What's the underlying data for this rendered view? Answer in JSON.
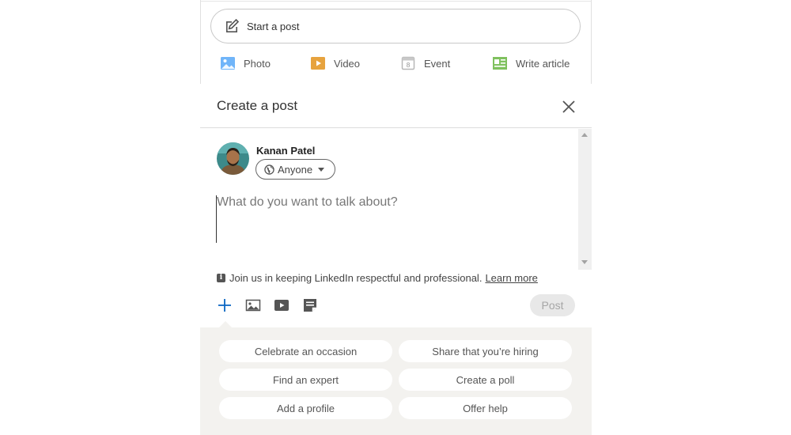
{
  "share_box": {
    "start_post_label": "Start a post",
    "actions": [
      {
        "label": "Photo",
        "icon": "photo-icon",
        "color": "#70b5f9"
      },
      {
        "label": "Video",
        "icon": "video-icon",
        "color": "#e7a33e"
      },
      {
        "label": "Event",
        "icon": "event-icon",
        "color": "#c0c0c0"
      },
      {
        "label": "Write article",
        "icon": "article-icon",
        "color": "#7fc15e"
      }
    ]
  },
  "modal": {
    "title": "Create a post",
    "close_icon": "close-icon",
    "author": {
      "name": "Kanan Patel"
    },
    "audience": {
      "selected": "Anyone",
      "icon": "globe-icon"
    },
    "editor": {
      "placeholder": "What do you want to talk about?"
    },
    "notice": {
      "text": "Join us in keeping LinkedIn respectful and professional.",
      "link": "Learn more"
    },
    "toolbar": [
      {
        "icon": "add-icon",
        "color": "#0a66c2"
      },
      {
        "icon": "image-icon"
      },
      {
        "icon": "video-icon"
      },
      {
        "icon": "document-icon"
      }
    ],
    "post_button": "Post",
    "suggestions": [
      "Celebrate an occasion",
      "Share that you’re hiring",
      "Find an expert",
      "Create a poll",
      "Add a profile",
      "Offer help"
    ]
  },
  "colors": {
    "accent": "#0a66c2",
    "tray_bg": "#f3f2ef"
  }
}
